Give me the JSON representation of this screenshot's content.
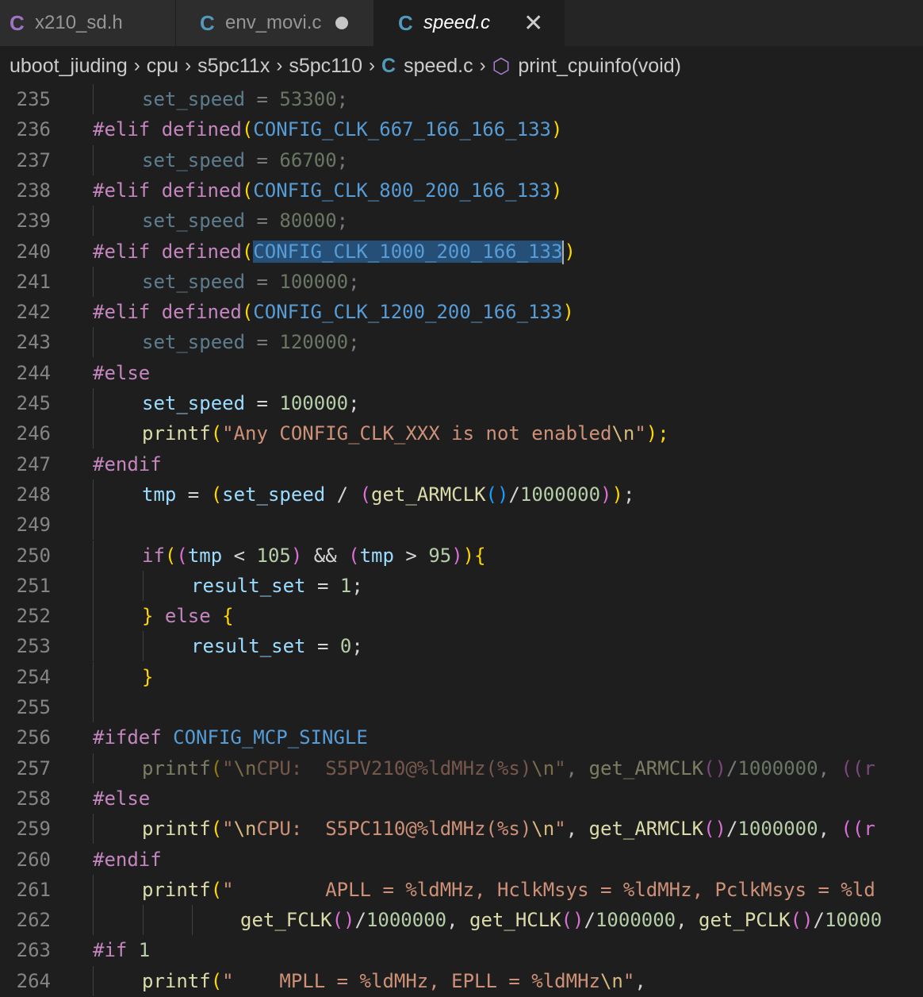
{
  "tabs": [
    {
      "icon": "C",
      "label": "x210_sd.h"
    },
    {
      "icon": "C",
      "label": "env_movi.c"
    },
    {
      "icon": "C",
      "label": "speed.c"
    }
  ],
  "breadcrumb": {
    "items": [
      "uboot_jiuding",
      "cpu",
      "s5pc11x",
      "s5pc110"
    ],
    "file_icon": "C",
    "file": "speed.c",
    "symbol": "print_cpuinfo(void)"
  },
  "lines": [
    {
      "n": "235",
      "t": [
        "set_speed",
        " = ",
        "53300",
        ";"
      ]
    },
    {
      "n": "236",
      "t": [
        "#elif",
        " defined",
        "(",
        "CONFIG_CLK_667_166_166_133",
        ")"
      ]
    },
    {
      "n": "237",
      "t": [
        "set_speed",
        " = ",
        "66700",
        ";"
      ]
    },
    {
      "n": "238",
      "t": [
        "#elif",
        " defined",
        "(",
        "CONFIG_CLK_800_200_166_133",
        ")"
      ]
    },
    {
      "n": "239",
      "t": [
        "set_speed",
        " = ",
        "80000",
        ";"
      ]
    },
    {
      "n": "240",
      "t": [
        "#elif",
        " defined",
        "(",
        "CONFIG_CLK_1000_200_166_133",
        ")"
      ]
    },
    {
      "n": "241",
      "t": [
        "set_speed",
        " = ",
        "100000",
        ";"
      ]
    },
    {
      "n": "242",
      "t": [
        "#elif",
        " defined",
        "(",
        "CONFIG_CLK_1200_200_166_133",
        ")"
      ]
    },
    {
      "n": "243",
      "t": [
        "set_speed",
        " = ",
        "120000",
        ";"
      ]
    },
    {
      "n": "244",
      "t": [
        "#else"
      ]
    },
    {
      "n": "245",
      "t": [
        "set_speed",
        " = ",
        "100000",
        ";"
      ]
    },
    {
      "n": "246",
      "t": [
        "printf",
        "(",
        "\"Any CONFIG_CLK_XXX is not enabled",
        "\\n",
        "\"",
        ");"
      ]
    },
    {
      "n": "247",
      "t": [
        "#endif"
      ]
    },
    {
      "n": "248",
      "t": [
        "tmp",
        " = ",
        "(",
        "set_speed",
        " / ",
        "(",
        "get_ARMCLK",
        "()",
        "/",
        "1000000",
        ")",
        ")",
        ";"
      ]
    },
    {
      "n": "249",
      "t": []
    },
    {
      "n": "250",
      "t": [
        "if",
        "(",
        "(",
        "tmp",
        " < ",
        "105",
        ")",
        " && ",
        "(",
        "tmp",
        " > ",
        "95",
        ")",
        ")",
        "{"
      ]
    },
    {
      "n": "251",
      "t": [
        "result_set",
        " = ",
        "1",
        ";"
      ]
    },
    {
      "n": "252",
      "t": [
        "}",
        " else ",
        "{"
      ]
    },
    {
      "n": "253",
      "t": [
        "result_set",
        " = ",
        "0",
        ";"
      ]
    },
    {
      "n": "254",
      "t": [
        "}"
      ]
    },
    {
      "n": "255",
      "t": []
    },
    {
      "n": "256",
      "t": [
        "#ifdef",
        " CONFIG_MCP_SINGLE"
      ]
    },
    {
      "n": "257",
      "t": [
        "printf",
        "(",
        "\"",
        "\\n",
        "CPU:  S5PV210@%ldMHz(%s)",
        "\\n",
        "\"",
        ", ",
        "get_ARMCLK",
        "()",
        "/",
        "1000000",
        ", ",
        "((r"
      ]
    },
    {
      "n": "258",
      "t": [
        "#else"
      ]
    },
    {
      "n": "259",
      "t": [
        "printf",
        "(",
        "\"",
        "\\n",
        "CPU:  S5PC110@%ldMHz(%s)",
        "\\n",
        "\"",
        ", ",
        "get_ARMCLK",
        "()",
        "/",
        "1000000",
        ", ",
        "((r"
      ]
    },
    {
      "n": "260",
      "t": [
        "#endif"
      ]
    },
    {
      "n": "261",
      "t": [
        "printf",
        "(",
        "\"        APLL = %ldMHz, HclkMsys = %ldMHz, PclkMsys = %ld"
      ]
    },
    {
      "n": "262",
      "t": [
        "get_FCLK",
        "()",
        "/",
        "1000000",
        ", ",
        "get_HCLK",
        "()",
        "/",
        "1000000",
        ", ",
        "get_PCLK",
        "()",
        "/",
        "10000"
      ]
    },
    {
      "n": "263",
      "t": [
        "#if",
        " 1"
      ]
    },
    {
      "n": "264",
      "t": [
        "printf",
        "(",
        "\"    MPLL = %ldMHz, EPLL = %ldMHz",
        "\\n",
        "\"",
        ","
      ]
    }
  ]
}
